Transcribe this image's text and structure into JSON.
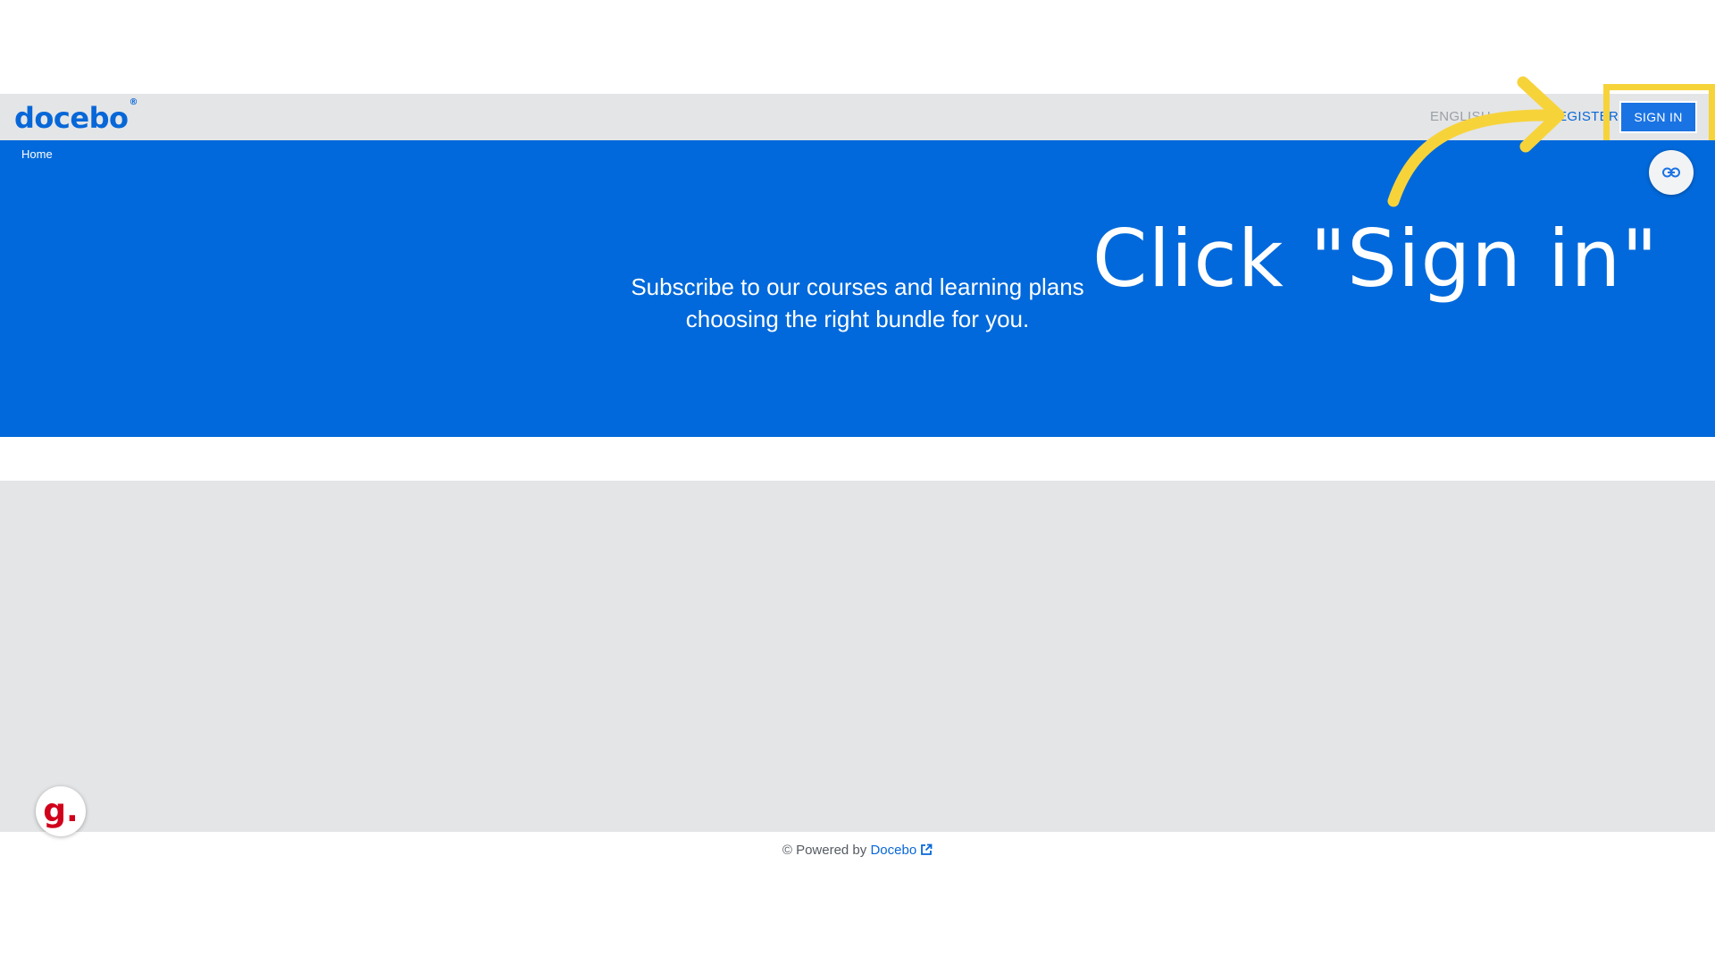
{
  "header": {
    "logo_text": "docebo",
    "logo_mark": "®",
    "language_label": "ENGLISH",
    "register_label": "REGISTER",
    "signin_label": "SIGN IN"
  },
  "hero": {
    "breadcrumb": "Home",
    "line1": "Subscribe to our courses and learning plans",
    "line2": "choosing the right bundle for you.",
    "link_icon": "link-icon"
  },
  "annotation": {
    "text": "Click \"Sign in\"",
    "highlight_color": "#f7d33a"
  },
  "footer": {
    "powered_by": "© Powered by",
    "brand": "Docebo",
    "external_icon": "external-link-icon"
  },
  "widgets": {
    "grammarly_letter": "g."
  },
  "colors": {
    "brand_blue": "#0169db",
    "header_gray": "#e4e5e6"
  }
}
